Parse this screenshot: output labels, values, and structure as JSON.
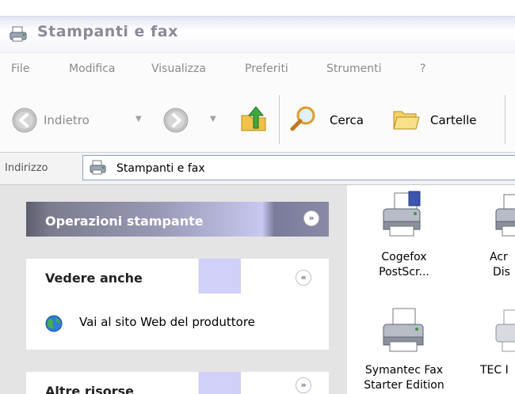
{
  "window": {
    "title": "Stampanti e fax"
  },
  "menu": [
    "File",
    "Modifica",
    "Visualizza",
    "Preferiti",
    "Strumenti",
    "?"
  ],
  "toolbar": {
    "back_label": "Indietro",
    "search_label": "Cerca",
    "folders_label": "Cartelle"
  },
  "address": {
    "label": "Indirizzo",
    "value": "Stampanti e fax"
  },
  "sidebar": {
    "printer_tasks": {
      "title": "Operazioni stampante"
    },
    "see_also": {
      "title": "Vedere anche",
      "links": [
        "Vai al sito Web del produttore"
      ]
    },
    "other_places": {
      "title": "Altre risorse"
    }
  },
  "printers": [
    {
      "line1": "Cogefox",
      "line2": "PostScr..."
    },
    {
      "line1": "Acr",
      "line2": "Dis"
    },
    {
      "line1": "Symantec Fax",
      "line2": "Starter Edition"
    },
    {
      "line1": "TEC I",
      "line2": ""
    }
  ],
  "colors": {
    "panel_header_dark": "#6a6a78",
    "panel_header_light": "#c8c8f0",
    "pane_background": "#e4e4e4"
  }
}
